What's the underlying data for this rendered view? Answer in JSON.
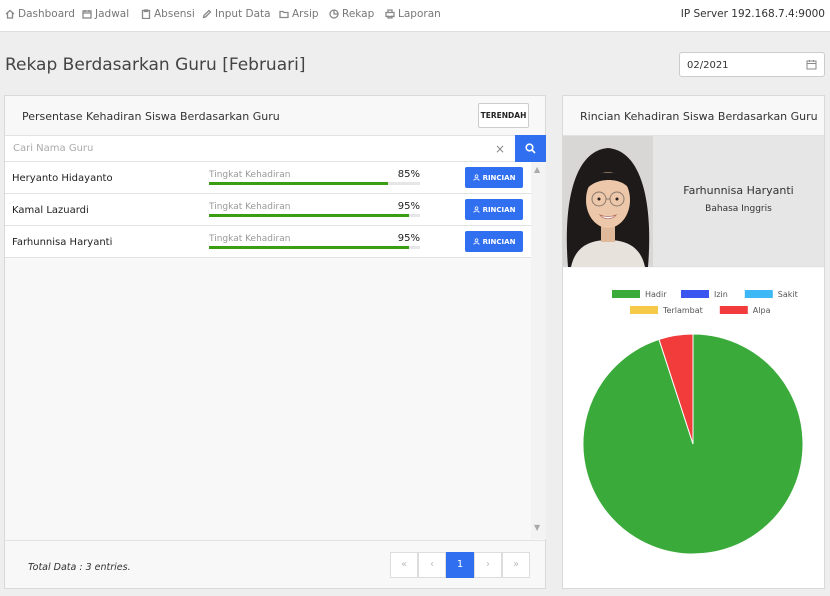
{
  "nav": {
    "items": [
      {
        "label": "Dashboard",
        "icon": "home-icon"
      },
      {
        "label": "Jadwal",
        "icon": "calendar-icon"
      },
      {
        "label": "Absensi",
        "icon": "clipboard-icon"
      },
      {
        "label": "Input Data",
        "icon": "pencil-icon"
      },
      {
        "label": "Arsip",
        "icon": "folder-icon"
      },
      {
        "label": "Rekap",
        "icon": "pie-icon"
      },
      {
        "label": "Laporan",
        "icon": "printer-icon"
      }
    ],
    "server": "IP Server 192.168.7.4:9000"
  },
  "page": {
    "title": "Rekap Berdasarkan Guru [Februari]",
    "date_value": "02/2021"
  },
  "left_panel": {
    "title": "Persentase Kehadiran Siswa Berdasarkan Guru",
    "sort_button": "TERENDAH",
    "search_placeholder": "Cari Nama Guru",
    "clear_symbol": "×",
    "rows": [
      {
        "name": "Heryanto Hidayanto",
        "metric_label": "Tingkat Kehadiran",
        "percent_text": "85%",
        "percent": 85,
        "button": "RINCIAN"
      },
      {
        "name": "Kamal Lazuardi",
        "metric_label": "Tingkat Kehadiran",
        "percent_text": "95%",
        "percent": 95,
        "button": "RINCIAN"
      },
      {
        "name": "Farhunnisa Haryanti",
        "metric_label": "Tingkat Kehadiran",
        "percent_text": "95%",
        "percent": 95,
        "button": "RINCIAN"
      }
    ],
    "total_text": "Total Data : 3 entries.",
    "pagination": [
      "«",
      "‹",
      "1",
      "›",
      "»"
    ],
    "current_page": "1"
  },
  "right_panel": {
    "title": "Rincian Kehadiran Siswa Berdasarkan Guru",
    "teacher_name": "Farhunnisa Haryanti",
    "subject": "Bahasa Inggris"
  },
  "chart_data": {
    "type": "pie",
    "legend": [
      {
        "label": "Hadir",
        "color": "#3aab3a"
      },
      {
        "label": "Izin",
        "color": "#3b55f0"
      },
      {
        "label": "Sakit",
        "color": "#3bb8f5"
      },
      {
        "label": "Terlambat",
        "color": "#f7c948"
      },
      {
        "label": "Alpa",
        "color": "#f23b3b"
      }
    ],
    "values": [
      95,
      0,
      0,
      0,
      5
    ],
    "legend_position": "top"
  }
}
